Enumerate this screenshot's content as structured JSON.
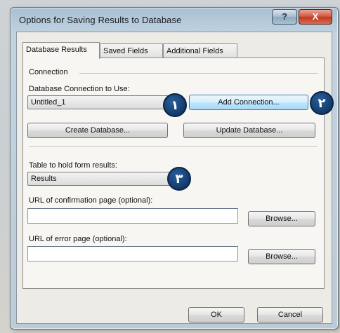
{
  "window": {
    "title": "Options for Saving Results to Database",
    "help_label": "?",
    "close_label": "X"
  },
  "tabs": [
    {
      "label": "Database Results",
      "active": true
    },
    {
      "label": "Saved Fields",
      "active": false
    },
    {
      "label": "Additional Fields",
      "active": false
    }
  ],
  "connection": {
    "group_label": "Connection",
    "db_label": "Database Connection to Use:",
    "db_value": "Untitled_1",
    "add_connection_label": "Add Connection...",
    "create_database_label": "Create Database...",
    "update_database_label": "Update Database..."
  },
  "table": {
    "label": "Table to hold form results:",
    "value": "Results"
  },
  "confirmation": {
    "label": "URL of confirmation page (optional):",
    "value": "",
    "browse_label": "Browse..."
  },
  "error_page": {
    "label": "URL of error page (optional):",
    "value": "",
    "browse_label": "Browse..."
  },
  "footer": {
    "ok_label": "OK",
    "cancel_label": "Cancel"
  },
  "badges": [
    "١",
    "٢",
    "٣"
  ]
}
